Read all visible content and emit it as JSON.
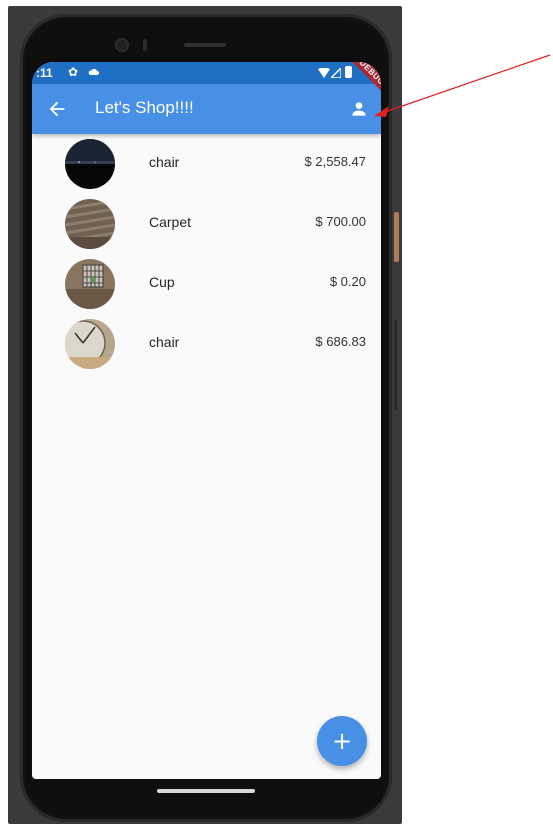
{
  "status_bar": {
    "time": ":11",
    "gear_icon": "gear-icon",
    "cloud_icon": "cloud-icon",
    "wifi_icon": "wifi-icon",
    "signal_icon": "signal-icon",
    "battery_icon": "battery-icon"
  },
  "debug_banner": {
    "label": "DEBUG"
  },
  "app_bar": {
    "title": "Let's Shop!!!!",
    "back_icon": "arrow-back-icon",
    "action_icon": "person-icon"
  },
  "products": [
    {
      "name": "chair",
      "price": "$ 2,558.47",
      "thumb": "night-scene"
    },
    {
      "name": "Carpet",
      "price": "$ 700.00",
      "thumb": "carpet"
    },
    {
      "name": "Cup",
      "price": "$ 0.20",
      "thumb": "room"
    },
    {
      "name": "chair",
      "price": "$ 686.83",
      "thumb": "clock"
    }
  ],
  "fab": {
    "label": "+"
  },
  "colors": {
    "app_bar": "#4790e6",
    "status_bar": "#1f6fc5",
    "debug_banner": "#a82a35",
    "annotation_arrow": "#e02020"
  }
}
